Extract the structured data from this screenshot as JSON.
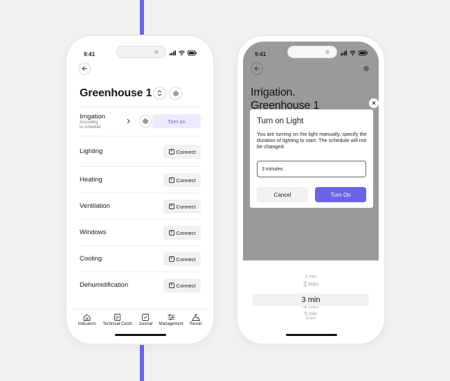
{
  "status": {
    "time": "9:41"
  },
  "left_phone": {
    "title": "Greenhouse 1",
    "irrigation": {
      "label": "Irrigation",
      "sub1": "According",
      "sub2": "to schedule",
      "button": "Turn on"
    },
    "rows": [
      {
        "label": "Lighting",
        "button": "Connect"
      },
      {
        "label": "Heating",
        "button": "Connect"
      },
      {
        "label": "Ventilation",
        "button": "Connect"
      },
      {
        "label": "Windows",
        "button": "Connect"
      },
      {
        "label": "Cooling",
        "button": "Connect"
      },
      {
        "label": "Dehumidification",
        "button": "Connect"
      }
    ],
    "nav": [
      "Indicators",
      "Technical Cards",
      "Journal",
      "Management",
      "Result"
    ]
  },
  "right_phone": {
    "title_line1": "Irrigation.",
    "title_line2": "Greenhouse 1",
    "dialog": {
      "title": "Turn on Light",
      "text": "You are turning on the light manually, specify the duration of lighting to start. The schedule will not be changed.",
      "input_value": "3 minutes",
      "cancel": "Cancel",
      "confirm": "Turn On"
    },
    "picker": [
      "1 min",
      "2 min",
      "3 min",
      "4 min",
      "5 min",
      "6 min"
    ],
    "picker_selected": "3 min"
  },
  "colors": {
    "accent": "#6b63e6",
    "overlay": "#9a9a9a",
    "pill_bg": "#eceaff"
  }
}
